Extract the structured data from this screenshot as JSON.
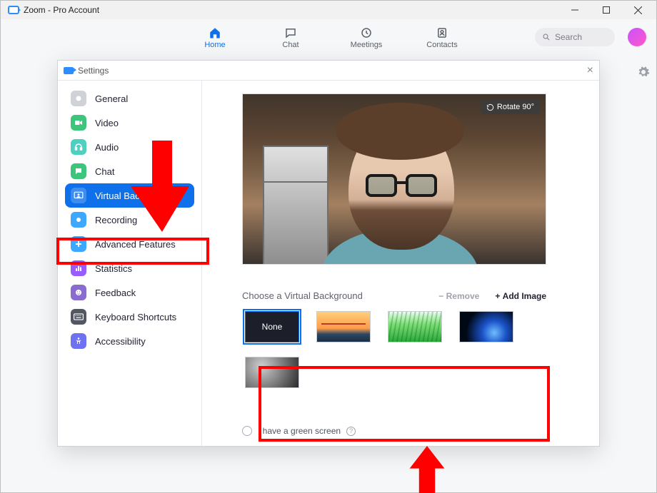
{
  "window": {
    "title": "Zoom - Pro Account"
  },
  "topnav": {
    "items": [
      {
        "label": "Home",
        "active": true
      },
      {
        "label": "Chat",
        "active": false
      },
      {
        "label": "Meetings",
        "active": false
      },
      {
        "label": "Contacts",
        "active": false
      }
    ],
    "search_placeholder": "Search"
  },
  "settings": {
    "title": "Settings",
    "sidebar": {
      "items": [
        {
          "label": "General"
        },
        {
          "label": "Video"
        },
        {
          "label": "Audio"
        },
        {
          "label": "Chat"
        },
        {
          "label": "Virtual Background",
          "active": true
        },
        {
          "label": "Recording"
        },
        {
          "label": "Advanced Features"
        },
        {
          "label": "Statistics"
        },
        {
          "label": "Feedback"
        },
        {
          "label": "Keyboard Shortcuts"
        },
        {
          "label": "Accessibility"
        }
      ]
    },
    "preview": {
      "rotate_label": "Rotate 90°"
    },
    "choose_label": "Choose a Virtual Background",
    "remove_label": "Remove",
    "add_image_label": "Add Image",
    "backgrounds": {
      "none_label": "None",
      "options": [
        {
          "id": "none",
          "label": "None",
          "selected": true
        },
        {
          "id": "golden-gate"
        },
        {
          "id": "grass"
        },
        {
          "id": "earth"
        },
        {
          "id": "smoke"
        }
      ]
    },
    "green_screen_label": "I have a green screen"
  },
  "colors": {
    "accent": "#0e71eb",
    "annotate": "#ff0000"
  }
}
